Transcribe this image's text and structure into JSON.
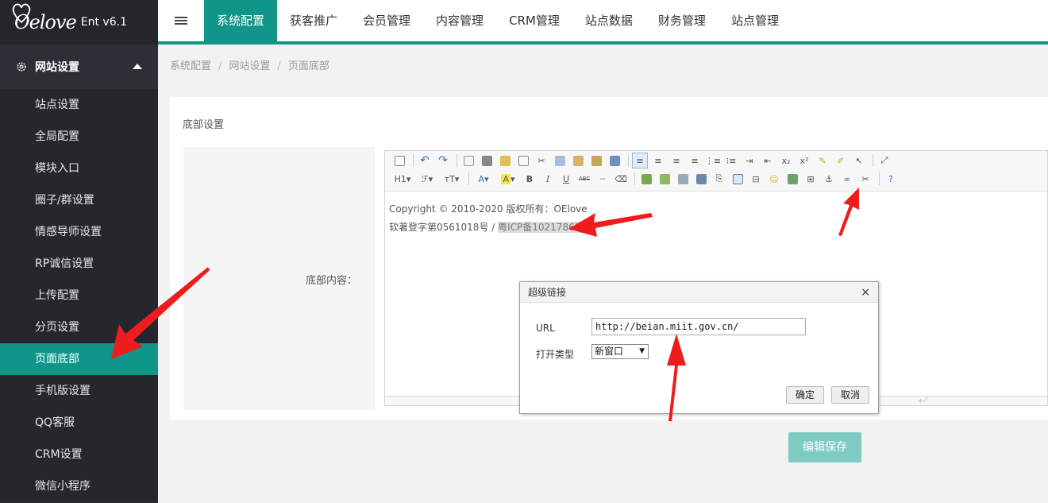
{
  "brand": {
    "logo_text": "Oelove",
    "version": "Ent v6.1"
  },
  "sidebar": {
    "group_label": "网站设置",
    "items": [
      {
        "label": "站点设置"
      },
      {
        "label": "全局配置"
      },
      {
        "label": "模块入口"
      },
      {
        "label": "圈子/群设置"
      },
      {
        "label": "情感导师设置"
      },
      {
        "label": "RP诚信设置"
      },
      {
        "label": "上传配置"
      },
      {
        "label": "分页设置"
      },
      {
        "label": "页面底部"
      },
      {
        "label": "手机版设置"
      },
      {
        "label": "QQ客服"
      },
      {
        "label": "CRM设置"
      },
      {
        "label": "微信小程序"
      }
    ]
  },
  "topnav": {
    "items": [
      {
        "label": "系统配置"
      },
      {
        "label": "获客推广"
      },
      {
        "label": "会员管理"
      },
      {
        "label": "内容管理"
      },
      {
        "label": "CRM管理"
      },
      {
        "label": "站点数据"
      },
      {
        "label": "财务管理"
      },
      {
        "label": "站点管理"
      }
    ]
  },
  "breadcrumb": {
    "items": [
      "系统配置",
      "网站设置",
      "页面底部"
    ],
    "separator": "/"
  },
  "card": {
    "title": "底部设置",
    "field_label": "底部内容："
  },
  "editor": {
    "toolbar_text": {
      "h1": "H1",
      "font": "ℱ",
      "size": "ᴛT",
      "bold": "B",
      "italic": "I",
      "underline": "U",
      "abc": "ABC"
    },
    "line1": "Copyright © 2010-2020    版权所有：OElove",
    "line2_prefix": "软著登字第0561018号 / ",
    "line2_highlight": "粤ICP备10217863号"
  },
  "dialog": {
    "title": "超级链接",
    "close": "×",
    "url_label": "URL",
    "url_value": "http://beian.miit.gov.cn/",
    "type_label": "打开类型",
    "type_value": "新窗口",
    "ok_label": "确定",
    "cancel_label": "取消"
  },
  "save_label": "编辑保存",
  "colors": {
    "accent": "#109688",
    "sidebar_bg": "#2c2f36",
    "annotation": "#ee1c1c"
  }
}
